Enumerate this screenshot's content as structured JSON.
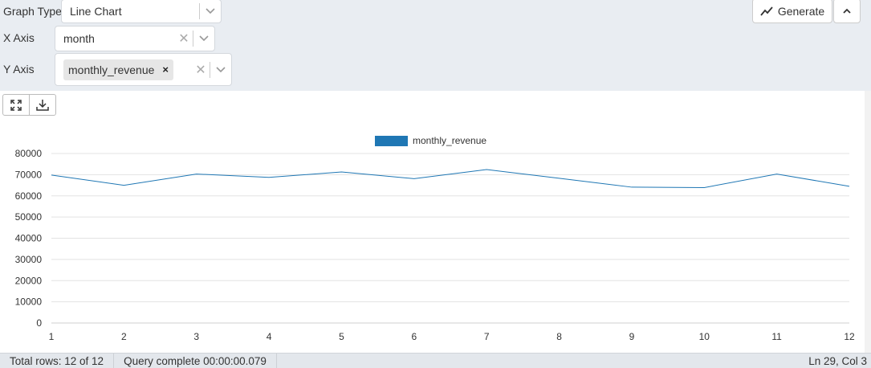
{
  "controls": {
    "graph_type": {
      "label": "Graph Type",
      "value": "Line Chart"
    },
    "x_axis": {
      "label": "X Axis",
      "value": "month"
    },
    "y_axis": {
      "label": "Y Axis",
      "chip": "monthly_revenue"
    },
    "generate_label": "Generate"
  },
  "status": {
    "rows": "Total rows: 12 of 12",
    "query": "Query complete 00:00:00.079",
    "cursor": "Ln 29, Col 3"
  },
  "colors": {
    "series": "#1f77b4"
  },
  "chart_data": {
    "type": "line",
    "x": [
      1,
      2,
      3,
      4,
      5,
      6,
      7,
      8,
      9,
      10,
      11,
      12
    ],
    "series": [
      {
        "name": "monthly_revenue",
        "values": [
          69800,
          65000,
          70300,
          68700,
          71300,
          68100,
          72400,
          68300,
          64100,
          63900,
          70300,
          64500
        ]
      }
    ],
    "xlim": [
      1,
      12
    ],
    "ylim": [
      0,
      80000
    ],
    "yticks": [
      0,
      10000,
      20000,
      30000,
      40000,
      50000,
      60000,
      70000,
      80000
    ],
    "legend": "top-center",
    "grid": true
  }
}
